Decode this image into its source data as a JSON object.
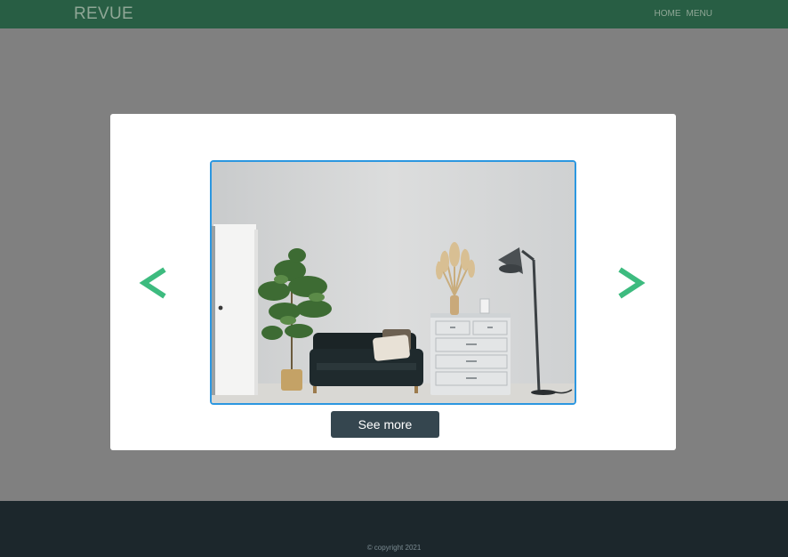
{
  "header": {
    "brand": "REVUE",
    "nav": [
      "HOME",
      "MENU"
    ]
  },
  "carousel": {
    "prev_icon": "chevron-left-icon",
    "next_icon": "chevron-right-icon",
    "image_subject": "living-room-photo",
    "button_label": "See more"
  },
  "footer": {
    "copyright": "© copyright 2021"
  },
  "colors": {
    "header_bg": "#285e44",
    "overlay": "#808080",
    "arrow": "#3dbb7f",
    "image_border": "#2c97e0",
    "button_bg": "#35464f",
    "footer_bg": "#1c272c"
  }
}
